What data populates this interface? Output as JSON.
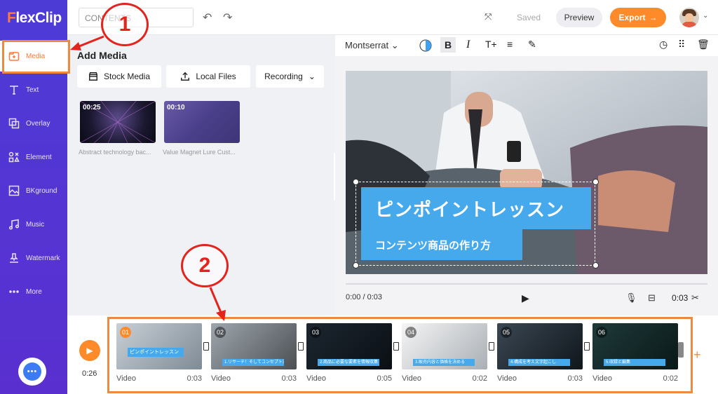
{
  "app": {
    "logo_first": "F",
    "logo_rest": "lexClip"
  },
  "sidebar": {
    "items": [
      {
        "label": "Media",
        "icon": "media-icon"
      },
      {
        "label": "Text",
        "icon": "text-icon"
      },
      {
        "label": "Overlay",
        "icon": "overlay-icon"
      },
      {
        "label": "Element",
        "icon": "element-icon"
      },
      {
        "label": "BKground",
        "icon": "background-icon"
      },
      {
        "label": "Music",
        "icon": "music-icon"
      },
      {
        "label": "Watermark",
        "icon": "watermark-icon"
      },
      {
        "label": "More",
        "icon": "more-icon"
      }
    ],
    "active": "Media"
  },
  "topbar": {
    "project_name": "CONTENTS",
    "saved_label": "Saved",
    "preview_label": "Preview",
    "export_label": "Export"
  },
  "panel": {
    "title": "Add Media",
    "buttons": {
      "stock": "Stock Media",
      "local": "Local Files",
      "recording": "Recording"
    },
    "media": [
      {
        "duration": "00:25",
        "caption": "Abstract technology bac..."
      },
      {
        "duration": "00:10",
        "caption": "Value Magnet Lure Cust..."
      }
    ]
  },
  "editor": {
    "font": "Montserrat",
    "title_text": "ピンポイントレッスン",
    "subtitle_text": "コンテンツ商品の作り方",
    "time_current": "0:00 / 0:03",
    "clip_duration": "0:03"
  },
  "timeline": {
    "total_time": "0:26",
    "clips": [
      {
        "num": "01",
        "type": "Video",
        "duration": "0:03",
        "caption": "ピンポイントレッスン"
      },
      {
        "num": "02",
        "type": "Video",
        "duration": "0:03",
        "caption": "1.リサーチ！そしてコンセプト決め"
      },
      {
        "num": "03",
        "type": "Video",
        "duration": "0:05",
        "caption": "2.商品に必要な要素を情報収集"
      },
      {
        "num": "04",
        "type": "Video",
        "duration": "0:02",
        "caption": "3.販売内容と価格を決める"
      },
      {
        "num": "05",
        "type": "Video",
        "duration": "0:03",
        "caption": "4.構成を考え文字起こし"
      },
      {
        "num": "06",
        "type": "Video",
        "duration": "0:02",
        "caption": "5.収録と編集"
      }
    ]
  },
  "annotations": {
    "one": "1",
    "two": "2"
  },
  "colors": {
    "accent": "#ff8a2a",
    "sidebar": "#4d3bd6",
    "highlight_box": "#ee8a3f",
    "callout": "#e3231c",
    "text_box": "#45a9ec"
  }
}
